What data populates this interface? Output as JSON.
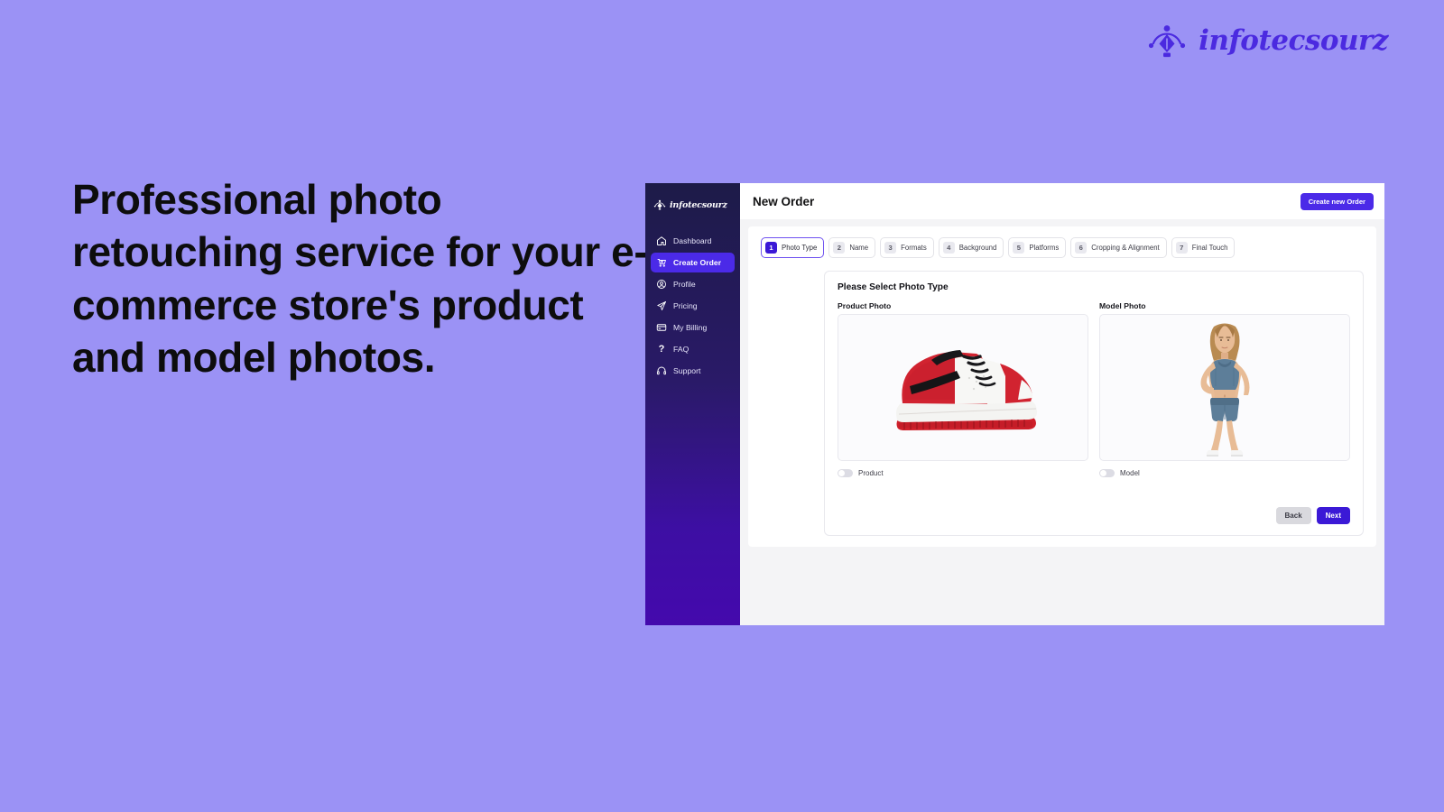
{
  "page": {
    "background_color": "#9b92f5",
    "headline": "Professional photo retouching service for your e-commerce store's product and model photos."
  },
  "brand": {
    "name": "infotecsourz",
    "logo_icon": "pen-tool-icon",
    "color": "#4b2ae0"
  },
  "app": {
    "sidebar": {
      "brand_name": "infotecsourz",
      "brand_icon": "pen-tool-icon",
      "items": [
        {
          "label": "Dashboard",
          "icon": "home-icon",
          "active": false
        },
        {
          "label": "Create Order",
          "icon": "cart-plus-icon",
          "active": true
        },
        {
          "label": "Profile",
          "icon": "user-circle-icon",
          "active": false
        },
        {
          "label": "Pricing",
          "icon": "paper-plane-icon",
          "active": false
        },
        {
          "label": "My Billing",
          "icon": "credit-card-icon",
          "active": false
        },
        {
          "label": "FAQ",
          "icon": "question-mark-icon",
          "active": false
        },
        {
          "label": "Support",
          "icon": "headset-icon",
          "active": false
        }
      ],
      "active_color": "#4b2ae8"
    },
    "topbar": {
      "title": "New Order",
      "create_order_label": "Create new Order",
      "accent_color": "#4b2ae8"
    },
    "stepper": {
      "steps": [
        {
          "num": "1",
          "label": "Photo Type",
          "active": true
        },
        {
          "num": "2",
          "label": "Name",
          "active": false
        },
        {
          "num": "3",
          "label": "Formats",
          "active": false
        },
        {
          "num": "4",
          "label": "Background",
          "active": false
        },
        {
          "num": "5",
          "label": "Platforms",
          "active": false
        },
        {
          "num": "6",
          "label": "Cropping & Alignment",
          "active": false
        },
        {
          "num": "7",
          "label": "Final Touch",
          "active": false
        }
      ]
    },
    "panel": {
      "title": "Please Select Photo Type",
      "options": [
        {
          "heading": "Product Photo",
          "image": "red-white-sneaker-photo",
          "toggle_label": "Product",
          "toggle_on": false
        },
        {
          "heading": "Model Photo",
          "image": "female-model-athletic-wear-photo",
          "toggle_label": "Model",
          "toggle_on": false
        }
      ],
      "back_label": "Back",
      "next_label": "Next"
    }
  }
}
